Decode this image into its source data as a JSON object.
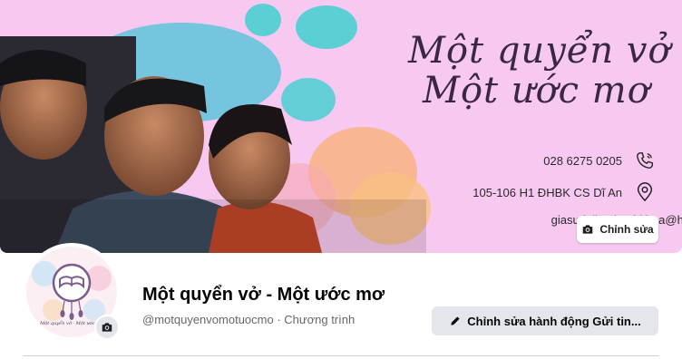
{
  "cover": {
    "tagline_line1": "Một quyển vở",
    "tagline_line2": "Một ước mơ",
    "phone": "028 6275 0205",
    "address": "105-106 H1 ĐHBK CS Dĩ An",
    "email": "giasudaihocbachkhoa@hcmut",
    "edit_label": "Chỉnh sửa"
  },
  "profile": {
    "avatar_caption": "Một quyển vở - Một ước mơ",
    "name": "Một quyển vở - Một ước mơ",
    "handle": "@motquyenvomotuocmo",
    "separator": " · ",
    "category": "Chương trình"
  },
  "actions": {
    "edit_action_label": "Chỉnh sửa hành động Gửi tin..."
  },
  "icons": {
    "phone": "phone-icon",
    "location": "location-pin-icon",
    "camera": "camera-icon",
    "pencil": "pencil-icon"
  }
}
